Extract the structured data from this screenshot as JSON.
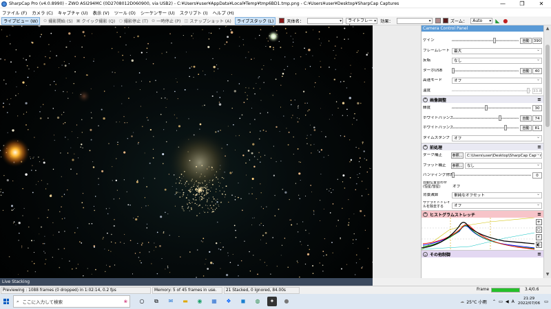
{
  "window": {
    "title": "SharpCap Pro (v4.0.8990) - ZWO ASI294MC (0D2708012D060900, via USB2) - C:¥Users¥user¥AppData¥Local¥Temp¥tmp6BD1.tmp.png - C:¥Users¥user¥Desktop¥SharpCap Captures",
    "minimize": "—",
    "maximize": "❐",
    "close": "✕"
  },
  "menu": [
    "ファイル (F)",
    "カメラ (C)",
    "キャプチャ (U)",
    "表示 (V)",
    "ツール (O)",
    "シーケンサー (U)",
    "スクリプト (I)",
    "ヘルプ (H)"
  ],
  "toolbar": {
    "live_view": "ライブビュー (W)",
    "start_capture": "撮影開始 (S)",
    "quick_capture": "クイック撮影 (Q)",
    "stop_capture": "撮影停止 (T)",
    "pause": "一時停止 (P)",
    "snapshot": "スナップショット (A)",
    "live_stack": "ライブスタック (L)",
    "target_name_label": "天体名：",
    "target_name_value": "",
    "light_frame": "ライトフレーム",
    "effect_label": "効果：",
    "effect_value": "",
    "zoom_label": "ズーム：",
    "zoom_value": "Auto",
    "accent_color": "#3a7bd5"
  },
  "panel": {
    "title": "Camera Control Panel",
    "rows_top": [
      {
        "label": "ゲイン",
        "auto": "自動",
        "value": "390",
        "thumb": 0.62
      },
      {
        "label": "フレームレート",
        "select": "最大"
      },
      {
        "label": "反転",
        "select": "なし"
      },
      {
        "label": "ターボUSB",
        "auto": "自動",
        "value": "40",
        "thumb": 0.0
      },
      {
        "label": "高速モード",
        "select": "オフ"
      },
      {
        "label": "温度",
        "value": "33.8",
        "disabled": true,
        "thumb": 0.95
      }
    ],
    "image_adjust": {
      "header": "画像調整",
      "rows": [
        {
          "label": "輝度",
          "value": "30",
          "thumb": 0.42
        },
        {
          "label": "ホワイトバランス(R)",
          "auto": "自動",
          "value": "74",
          "thumb": 0.7
        },
        {
          "label": "ホワイトバランス(B)",
          "auto": "自動",
          "value": "81",
          "thumb": 0.78
        },
        {
          "label": "タイムスタンプ",
          "select": "オフ"
        }
      ]
    },
    "preprocess": {
      "header": "前処理",
      "dark_label": "ダーク補正",
      "dark_button": "参照...",
      "dark_path": "C:\\Users\\user\\Desktop\\SharpCap Captures\\Darks\\",
      "flat_label": "フラット補正",
      "flat_button": "参照...",
      "flat_value": "なし",
      "banding_label": "バンディング除去",
      "banding_value": "0",
      "auto_align_label": "自動位置合わせ (恒星/彗星)",
      "auto_align_value": "オフ",
      "background_label": "背景減算",
      "background_value": "単純なオフセット",
      "satellite_label": "サテライトトレイルを除去する",
      "satellite_value": "オフ"
    },
    "histogram": {
      "header": "ヒストグラムストレッチ"
    },
    "other": {
      "header": "その他制御"
    }
  },
  "live_stacking_tab": "Live Stacking",
  "status": {
    "previewing": "Previewing : 1088 frames (0 dropped) in 1:02:14, 0.2 fps",
    "memory": "Memory: 5 of 45 frames in use.",
    "stacked": "21 Stacked, 0 Ignored, 84.00s",
    "frame_label": "Frame :",
    "frame_progress": 1.0,
    "frame_value": "3.4/0.6"
  },
  "taskbar": {
    "search_placeholder": "ここに入力して検索",
    "weather": "25°C  小雨",
    "ime": "A",
    "time": "21:29",
    "date": "2022/07/06"
  }
}
